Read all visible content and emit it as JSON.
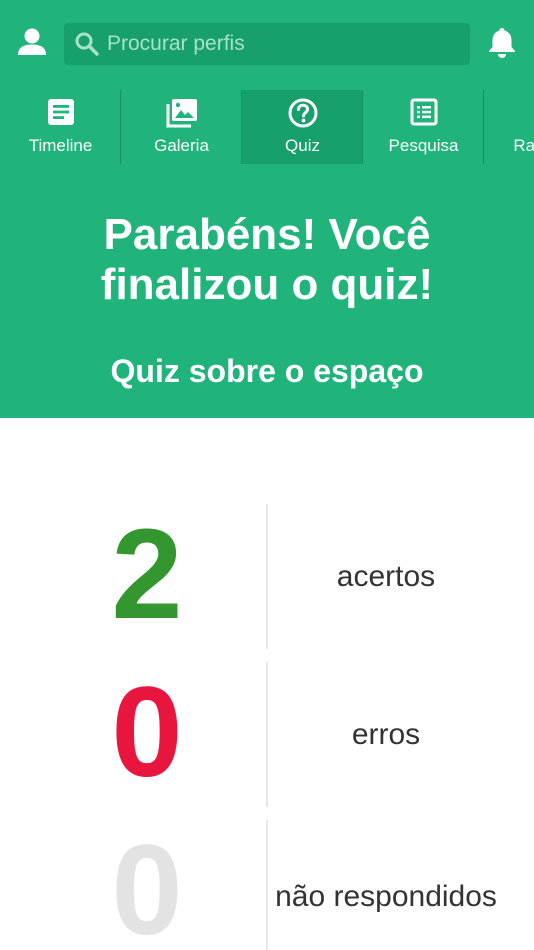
{
  "topbar": {
    "profile_icon": "user-icon",
    "search_placeholder": "Procurar perfis",
    "search_value": "",
    "search_icon": "search-icon",
    "notifications_icon": "bell-icon"
  },
  "tabs": [
    {
      "label": "Timeline",
      "icon": "article-icon",
      "active": false
    },
    {
      "label": "Galeria",
      "icon": "gallery-icon",
      "active": false
    },
    {
      "label": "Quiz",
      "icon": "question-circle-icon",
      "active": true
    },
    {
      "label": "Pesquisa",
      "icon": "list-icon",
      "active": false
    },
    {
      "label": "Ranking",
      "icon": "ranking-icon",
      "active": false
    }
  ],
  "header": {
    "title": "Parabéns! Você finalizou o quiz!",
    "subtitle": "Quiz sobre o espaço"
  },
  "results": [
    {
      "value": "2",
      "label": "acertos",
      "color": "#34962e"
    },
    {
      "value": "0",
      "label": "erros",
      "color": "#e8163f"
    },
    {
      "value": "0",
      "label": "não respondidos",
      "color": "#e3e3e3"
    }
  ],
  "colors": {
    "primary": "#20b47c",
    "primary_dark": "#17a06b"
  }
}
